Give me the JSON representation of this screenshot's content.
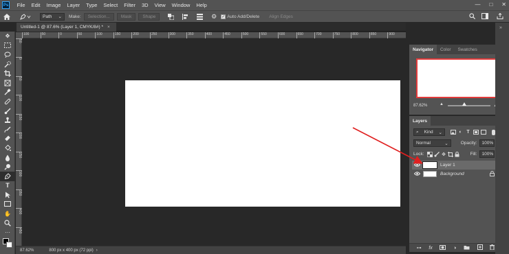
{
  "app": {
    "logo": "Ps"
  },
  "menu": [
    "File",
    "Edit",
    "Image",
    "Layer",
    "Type",
    "Select",
    "Filter",
    "3D",
    "View",
    "Window",
    "Help"
  ],
  "window_controls": {
    "minimize": "—",
    "maximize": "□",
    "close": "✕"
  },
  "options_bar": {
    "home_icon": "home-icon",
    "path_mode": "Path",
    "make_label": "Make:",
    "selection_btn": "Selection...",
    "mask_btn": "Mask",
    "shape_btn": "Shape",
    "auto_add_delete": "Auto Add/Delete",
    "auto_add_checked": true,
    "align_edges": "Align Edges"
  },
  "document": {
    "tab_title": "Untitled-1 @ 87.6% (Layer 1, CMYK/8#) *",
    "close": "×"
  },
  "ruler": {
    "top_ticks": [
      "100",
      "50",
      "0",
      "50",
      "100",
      "150",
      "200",
      "250",
      "300",
      "350",
      "400",
      "450",
      "500",
      "550",
      "600",
      "650",
      "700",
      "750",
      "800",
      "850",
      "900"
    ],
    "left_ticks": [
      "50",
      "0",
      "50",
      "100",
      "150",
      "200",
      "250",
      "300",
      "350",
      "400",
      "450"
    ]
  },
  "status": {
    "zoom": "87.62%",
    "doc_info": "800 px x 400 px (72 ppi)"
  },
  "navigator": {
    "tabs": [
      "Navigator",
      "Color",
      "Swatches"
    ],
    "zoom": "87.62%"
  },
  "layers": {
    "tab": "Layers",
    "filter_kind": "Kind",
    "blend_mode": "Normal",
    "opacity_label": "Opacity:",
    "opacity_value": "100%",
    "lock_label": "Lock:",
    "fill_label": "Fill:",
    "fill_value": "100%",
    "items": [
      {
        "name": "Layer 1",
        "selected": true,
        "locked": false
      },
      {
        "name": "Background",
        "selected": false,
        "locked": true
      }
    ]
  },
  "annotation": {
    "arrow_color": "#e02020"
  },
  "colors": {
    "ui_panel": "#535353",
    "ui_dark": "#282828",
    "canvas": "#ffffff",
    "accent_red": "#e23b3b"
  }
}
